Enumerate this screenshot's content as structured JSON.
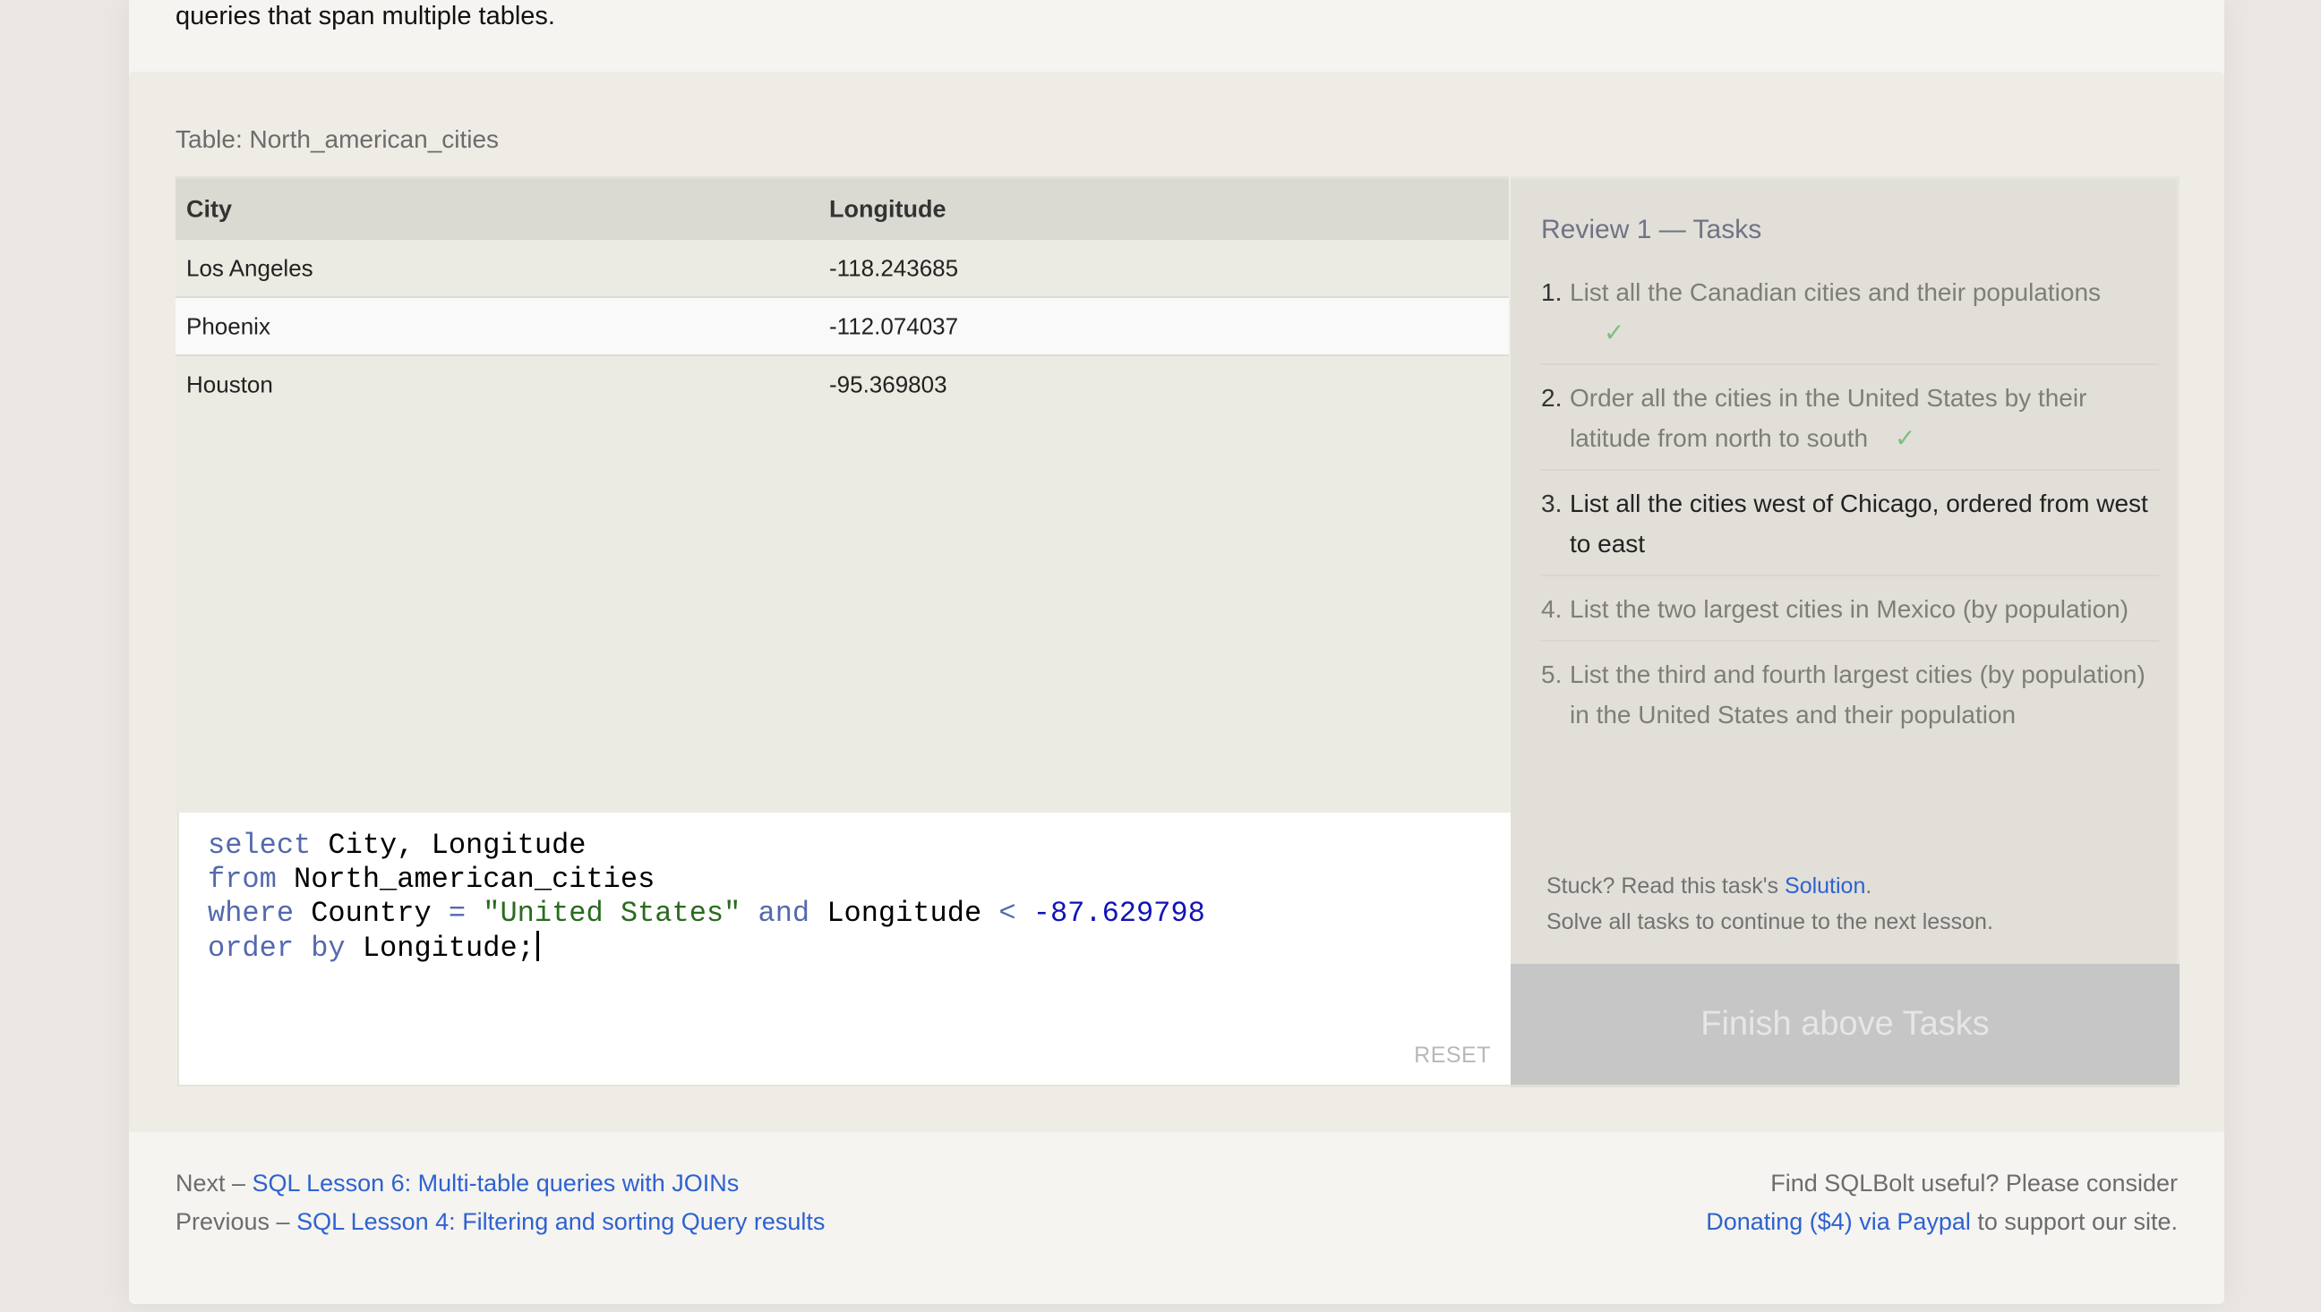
{
  "intro": {
    "text": "queries that span multiple tables."
  },
  "exercise": {
    "table_label": "Table: North_american_cities",
    "results": {
      "columns": [
        "City",
        "Longitude"
      ],
      "rows": [
        [
          "Los Angeles",
          "-118.243685"
        ],
        [
          "Phoenix",
          "-112.074037"
        ],
        [
          "Houston",
          "-95.369803"
        ]
      ]
    },
    "editor": {
      "lines": [
        [
          {
            "t": "select",
            "c": "kw"
          },
          {
            "t": " City, Longitude",
            "c": ""
          }
        ],
        [
          {
            "t": "from",
            "c": "kw"
          },
          {
            "t": " North_american_cities",
            "c": ""
          }
        ],
        [
          {
            "t": "where",
            "c": "kw"
          },
          {
            "t": " Country ",
            "c": ""
          },
          {
            "t": "=",
            "c": "op"
          },
          {
            "t": " ",
            "c": ""
          },
          {
            "t": "\"United States\"",
            "c": "str"
          },
          {
            "t": " ",
            "c": ""
          },
          {
            "t": "and",
            "c": "kw"
          },
          {
            "t": " Longitude ",
            "c": ""
          },
          {
            "t": "<",
            "c": "op"
          },
          {
            "t": " ",
            "c": ""
          },
          {
            "t": "-87.629798",
            "c": "num"
          }
        ],
        [
          {
            "t": "order by",
            "c": "kw"
          },
          {
            "t": " Longitude;",
            "c": ""
          }
        ]
      ],
      "reset_label": "RESET"
    },
    "tasks": {
      "title": "Review 1 — Tasks",
      "items": [
        {
          "number": "1.",
          "text": "List all the Canadian cities and their populations",
          "status": "done",
          "check": "✓"
        },
        {
          "number": "2.",
          "text": "Order all the cities in the United States by their latitude from north to south",
          "status": "done",
          "check": "✓"
        },
        {
          "number": "3.",
          "text": "List all the cities west of Chicago, ordered from west to east",
          "status": "current",
          "check": ""
        },
        {
          "number": "4.",
          "text": "List the two largest cities in Mexico (by population)",
          "status": "todo",
          "check": ""
        },
        {
          "number": "5.",
          "text": "List the third and fourth largest cities (by population) in the United States and their population",
          "status": "todo",
          "check": ""
        }
      ],
      "hint_prefix": "Stuck? Read this task's ",
      "hint_link": "Solution",
      "hint_suffix": ".",
      "hint_line2": "Solve all tasks to continue to the next lesson.",
      "finish_label": "Finish above Tasks"
    }
  },
  "footer": {
    "next_prefix": "Next – ",
    "next_link": "SQL Lesson 6: Multi-table queries with JOINs",
    "prev_prefix": "Previous – ",
    "prev_link": "SQL Lesson 4: Filtering and sorting Query results",
    "donate_line1": "Find SQLBolt useful? Please consider",
    "donate_link": "Donating ($4) via Paypal",
    "donate_suffix": " to support our site."
  },
  "colors": {
    "link": "#2e62cf",
    "keyword": "#5469ad",
    "string": "#2a6b1f",
    "number": "#1212b8",
    "check": "#7dbf7d",
    "finish_button_bg": "#c6c6c6"
  }
}
